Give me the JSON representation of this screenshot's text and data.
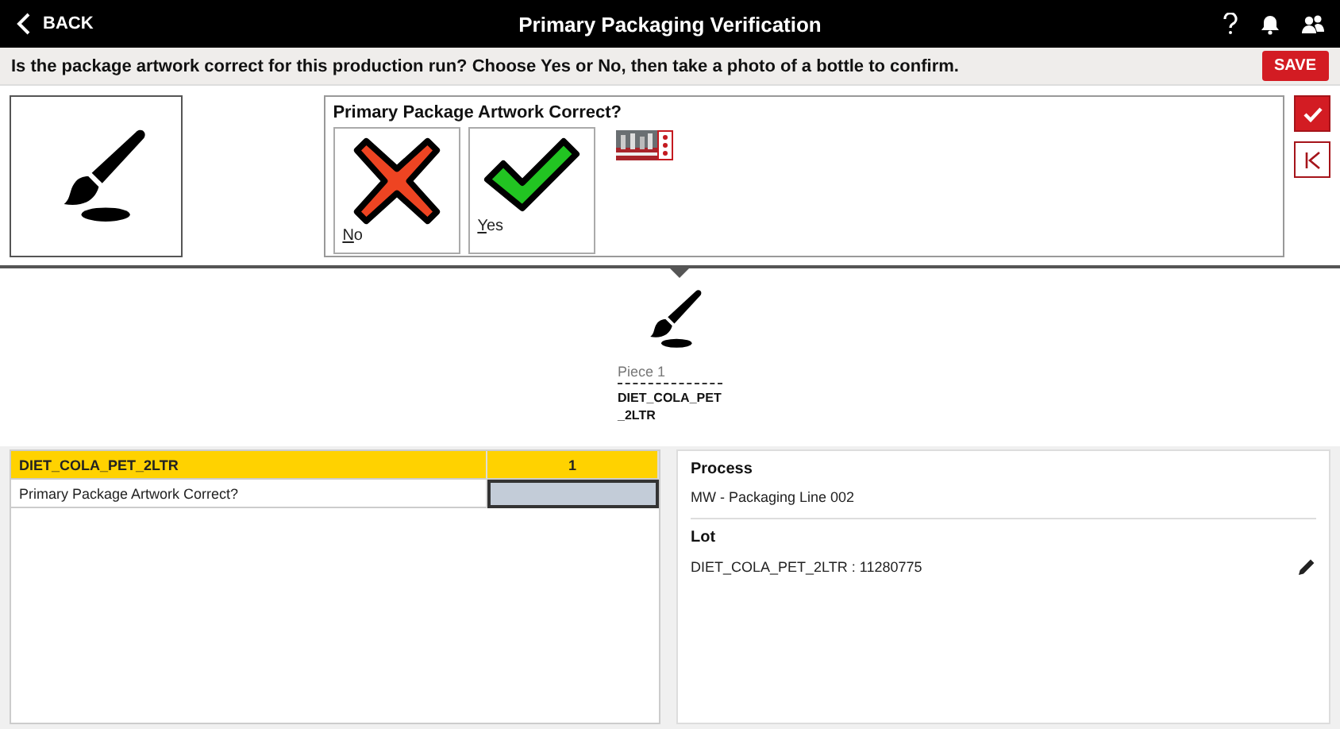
{
  "header": {
    "back": "BACK",
    "title": "Primary Packaging Verification"
  },
  "instruction": {
    "text": "Is the package artwork correct for this production run? Choose Yes or No, then take a photo of a bottle to confirm.",
    "save": "SAVE"
  },
  "question": {
    "title": "Primary Package Artwork Correct?",
    "options": [
      {
        "kind": "no",
        "label": "No",
        "selected": false
      },
      {
        "kind": "yes",
        "label": "Yes",
        "selected": false
      }
    ]
  },
  "piece": {
    "label": "Piece 1",
    "name": "DIET_COLA_PET_2LTR"
  },
  "table": {
    "header": {
      "name": "DIET_COLA_PET_2LTR",
      "count": "1"
    },
    "rows": [
      {
        "label": "Primary Package Artwork Correct?",
        "value_selected": true
      }
    ]
  },
  "details": [
    {
      "heading": "Process",
      "value": "MW - Packaging Line 002"
    },
    {
      "heading": "Lot",
      "value": "DIET_COLA_PET_2LTR : 11280775",
      "editable": true
    }
  ]
}
